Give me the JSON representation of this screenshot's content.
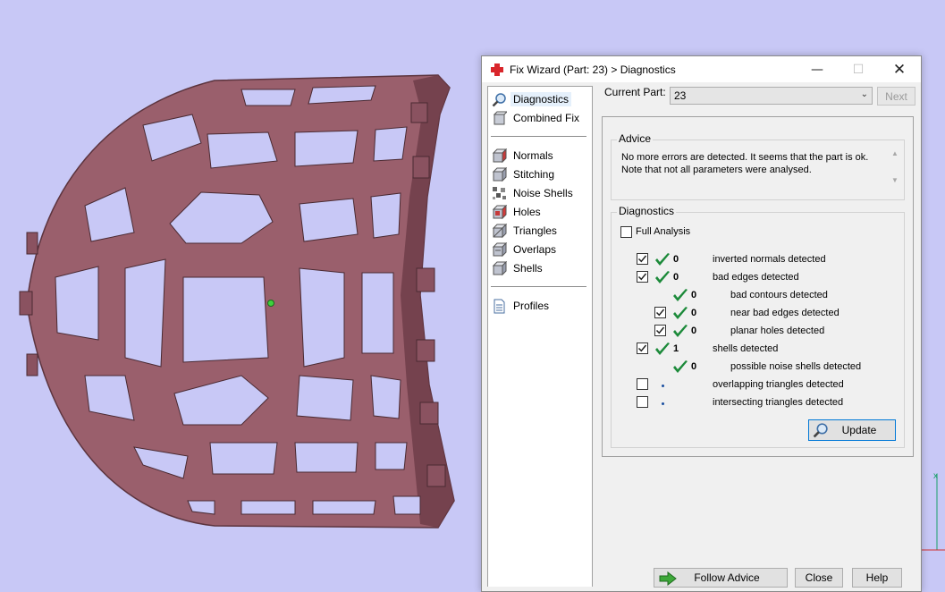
{
  "window": {
    "title": "Fix Wizard (Part: 23) > Diagnostics",
    "controls": [
      "minimize",
      "maximize",
      "close"
    ]
  },
  "nav": {
    "items": [
      {
        "label": "Diagnostics",
        "icon": "magnifier-icon",
        "active": true
      },
      {
        "label": "Combined Fix",
        "icon": "combined-fix-icon"
      },
      {
        "label": "Normals",
        "icon": "normals-cube-icon"
      },
      {
        "label": "Stitching",
        "icon": "stitching-cube-icon"
      },
      {
        "label": "Noise Shells",
        "icon": "noise-shells-icon"
      },
      {
        "label": "Holes",
        "icon": "holes-cube-icon"
      },
      {
        "label": "Triangles",
        "icon": "triangles-cube-icon"
      },
      {
        "label": "Overlaps",
        "icon": "overlaps-cube-icon"
      },
      {
        "label": "Shells",
        "icon": "shells-cube-icon"
      },
      {
        "label": "Profiles",
        "icon": "document-icon"
      }
    ]
  },
  "current_part": {
    "label": "Current Part:",
    "value": "23",
    "next_label": "Next"
  },
  "advice": {
    "group_label": "Advice",
    "line1": "No more errors are detected. It seems that the part is ok.",
    "line2": "Note that not all parameters were analysed."
  },
  "diagnostics": {
    "group_label": "Diagnostics",
    "full_analysis_label": "Full Analysis",
    "full_analysis_checked": false,
    "rows": [
      {
        "checkbox": true,
        "checked": true,
        "status": "ok",
        "count": "0",
        "text": "inverted normals detected",
        "indent": 0
      },
      {
        "checkbox": true,
        "checked": true,
        "status": "ok",
        "count": "0",
        "text": "bad edges detected",
        "indent": 0
      },
      {
        "checkbox": false,
        "checked": false,
        "status": "ok",
        "count": "0",
        "text": "bad contours detected",
        "indent": 1
      },
      {
        "checkbox": true,
        "checked": true,
        "status": "ok",
        "count": "0",
        "text": "near bad edges detected",
        "indent": 1
      },
      {
        "checkbox": true,
        "checked": true,
        "status": "ok",
        "count": "0",
        "text": "planar holes detected",
        "indent": 1
      },
      {
        "checkbox": true,
        "checked": true,
        "status": "ok",
        "count": "1",
        "text": "shells detected",
        "indent": 0
      },
      {
        "checkbox": false,
        "checked": false,
        "status": "ok",
        "count": "0",
        "text": "possible noise shells detected",
        "indent": 1
      },
      {
        "checkbox": true,
        "checked": false,
        "status": "pending",
        "count": "",
        "text": "overlapping triangles detected",
        "indent": 0
      },
      {
        "checkbox": true,
        "checked": false,
        "status": "pending",
        "count": "",
        "text": "intersecting triangles detected",
        "indent": 0
      }
    ],
    "update_label": "Update"
  },
  "footer": {
    "follow_advice_label": "Follow Advice",
    "close_label": "Close",
    "help_label": "Help"
  },
  "colors": {
    "viewport_bg": "#c8c8f6",
    "part_fill": "#9a5f6c",
    "check_green": "#1c8a3a",
    "accent_blue": "#0078d7"
  }
}
